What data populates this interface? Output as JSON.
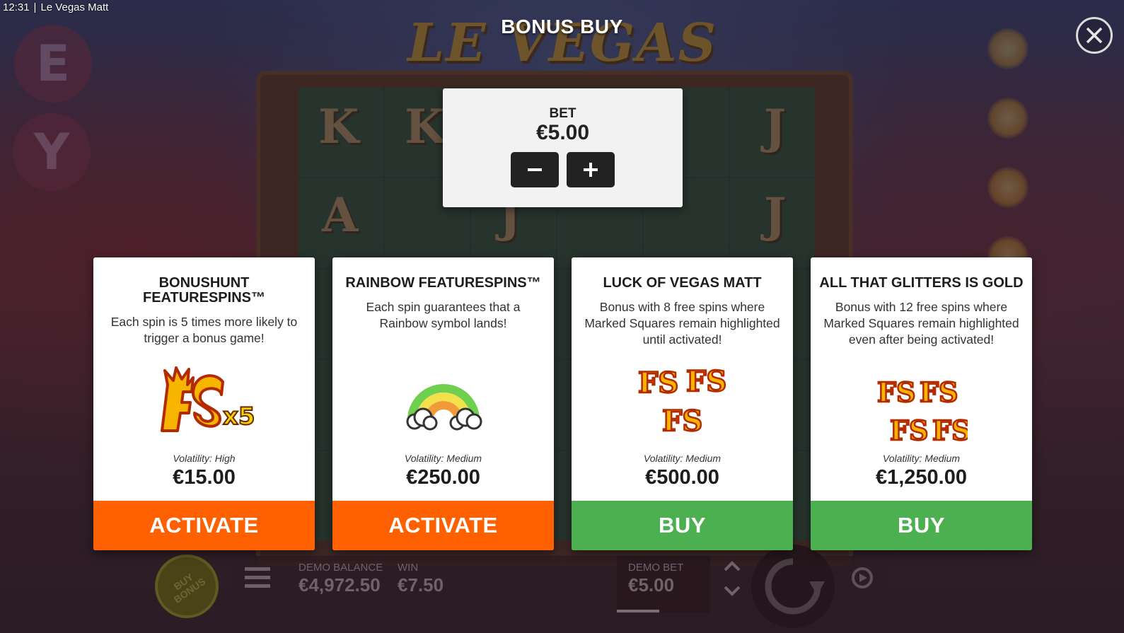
{
  "status_bar": {
    "time": "12:31",
    "separator": "|",
    "app_title": "Le Vegas Matt"
  },
  "background": {
    "game_logo": "LE VEGAS MATT",
    "reel_symbols": [
      "K",
      "K",
      "J",
      "A",
      "J",
      "J"
    ]
  },
  "modal": {
    "title": "BONUS BUY",
    "close_icon": "close-icon",
    "bet": {
      "label": "BET",
      "value": "€5.00",
      "decrease_icon": "minus-icon",
      "increase_icon": "plus-icon"
    },
    "cards": [
      {
        "title": "BONUSHUNT FEATURESPINS™",
        "description": "Each spin is 5 times more likely to trigger a bonus game!",
        "art": "fs-x5-icon",
        "art_text": "x5",
        "volatility": "Volatility: High",
        "price": "€15.00",
        "action": "ACTIVATE",
        "action_color": "#ff6100"
      },
      {
        "title": "RAINBOW FEATURESPINS™",
        "description": "Each spin guarantees that a Rainbow symbol lands!",
        "art": "rainbow-icon",
        "volatility": "Volatility: Medium",
        "price": "€250.00",
        "action": "ACTIVATE",
        "action_color": "#ff6100"
      },
      {
        "title": "LUCK OF VEGAS MATT",
        "description": "Bonus with 8 free spins where Marked Squares remain highlighted until activated!",
        "art": "fs-triple-icon",
        "volatility": "Volatility: Medium",
        "price": "€500.00",
        "action": "BUY",
        "action_color": "#4caf50"
      },
      {
        "title": "ALL THAT GLITTERS IS GOLD",
        "description": "Bonus with 12 free spins where Marked Squares remain highlighted even after being activated!",
        "art": "fs-quad-icon",
        "volatility": "Volatility: Medium",
        "price": "€1,250.00",
        "action": "BUY",
        "action_color": "#4caf50"
      }
    ]
  },
  "hud": {
    "buy_bonus_label": "BUY BONUS",
    "menu_icon": "menu-icon",
    "balance_label": "DEMO BALANCE",
    "balance_value": "€4,972.50",
    "win_label": "WIN",
    "win_value": "€7.50",
    "bet_label": "DEMO BET",
    "bet_value": "€5.00",
    "stepper_icon": "chevron-up-down-icon",
    "spin_icon": "spin-icon",
    "autoplay_icon": "autoplay-icon"
  },
  "colors": {
    "activate": "#ff6100",
    "buy": "#4caf50",
    "panel": "#f2f2f2",
    "card": "#ffffff",
    "dark_button": "#222222"
  }
}
